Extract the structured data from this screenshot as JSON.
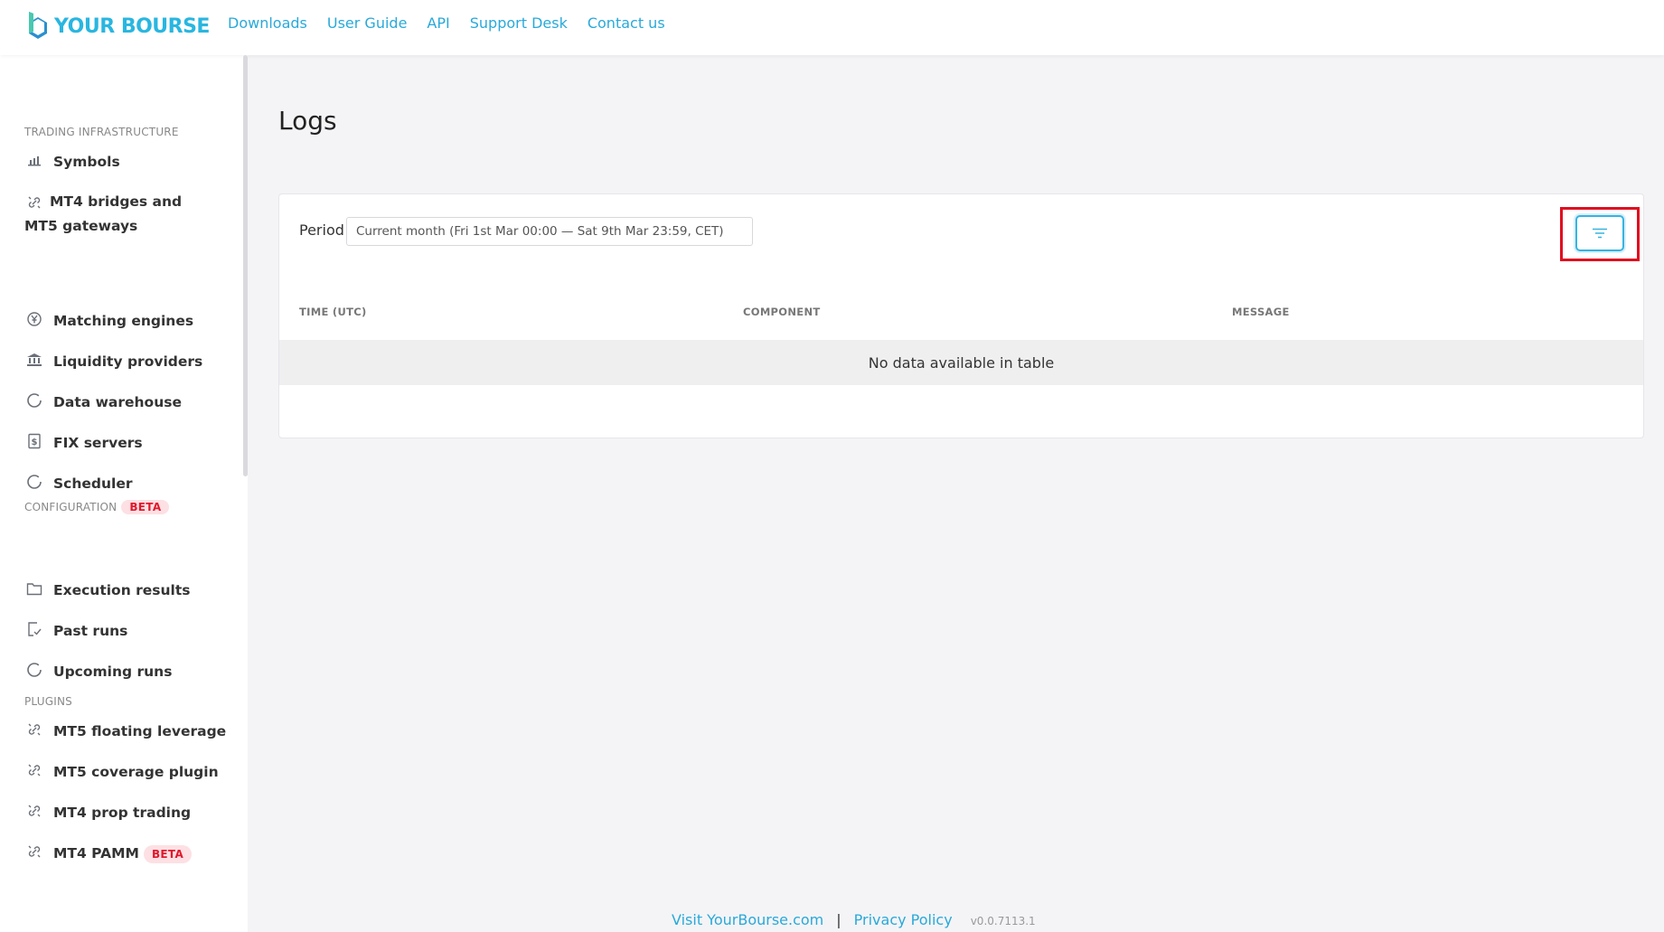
{
  "brand": {
    "name": "YOUR BOURSE"
  },
  "nav": [
    "Downloads",
    "User Guide",
    "API",
    "Support Desk",
    "Contact us"
  ],
  "sidebar": {
    "sections": [
      {
        "title": "TRADING INFRASTRUCTURE",
        "items": [
          {
            "label": "Symbols",
            "icon": "bar-chart-icon"
          },
          {
            "label": "MT4 bridges and MT5 gateways",
            "icon": "link-icon"
          },
          {
            "label": "Matching engines",
            "icon": "yen-coin-icon"
          },
          {
            "label": "Liquidity providers",
            "icon": "bank-icon"
          },
          {
            "label": "Data warehouse",
            "icon": "circle-icon"
          },
          {
            "label": "FIX servers",
            "icon": "document-dollar-icon"
          },
          {
            "label": "Scheduler",
            "icon": "circle-icon"
          }
        ]
      },
      {
        "title": "CONFIGURATION",
        "badge": "BETA",
        "items": [
          {
            "label": "Execution results",
            "icon": "folder-icon"
          },
          {
            "label": "Past runs",
            "icon": "check-document-icon"
          },
          {
            "label": "Upcoming runs",
            "icon": "circle-icon"
          }
        ]
      },
      {
        "title": "PLUGINS",
        "items": [
          {
            "label": "MT5 floating leverage",
            "icon": "link-icon"
          },
          {
            "label": "MT5 coverage plugin",
            "icon": "link-icon"
          },
          {
            "label": "MT4 prop trading",
            "icon": "link-icon"
          },
          {
            "label": "MT4 PAMM",
            "icon": "link-icon",
            "badge": "BETA"
          }
        ]
      }
    ]
  },
  "main": {
    "title": "Logs",
    "period_label": "Period",
    "period_value": "Current month (Fri 1st Mar 00:00 — Sat 9th Mar 23:59, CET)",
    "filter_icon": "filter-icon",
    "columns": [
      "TIME (UTC)",
      "COMPONENT",
      "MESSAGE"
    ],
    "empty_message": "No data available in table"
  },
  "footer": {
    "visit_link": "Visit YourBourse.com",
    "separator": "|",
    "privacy_link": "Privacy Policy",
    "version": "v0.0.7113.1"
  },
  "colors": {
    "accent": "#29a9da",
    "highlight": "#e00c1f",
    "beta_bg": "#fde0e3",
    "beta_text": "#e0182d"
  }
}
